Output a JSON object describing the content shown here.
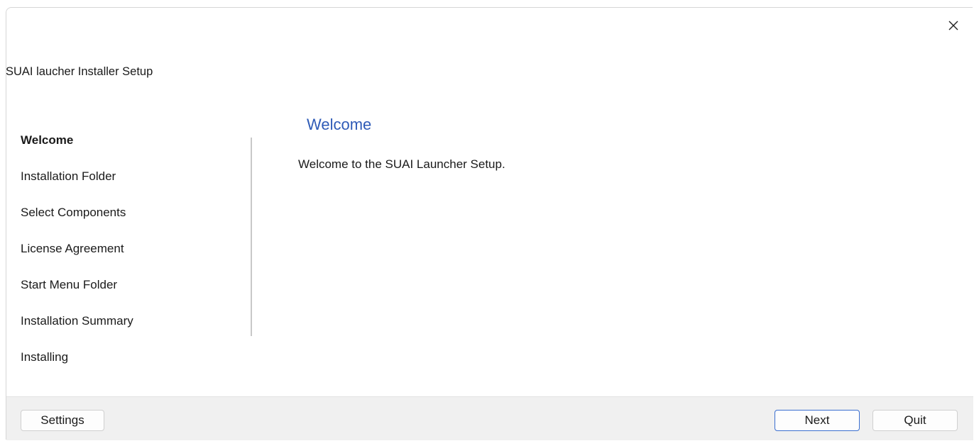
{
  "window": {
    "title": "SUAI laucher Installer Setup",
    "close_icon": "close-icon"
  },
  "sidebar": {
    "items": [
      {
        "label": "Welcome",
        "active": true
      },
      {
        "label": "Installation Folder",
        "active": false
      },
      {
        "label": "Select Components",
        "active": false
      },
      {
        "label": "License Agreement",
        "active": false
      },
      {
        "label": "Start Menu Folder",
        "active": false
      },
      {
        "label": "Installation Summary",
        "active": false
      },
      {
        "label": "Installing",
        "active": false
      }
    ]
  },
  "page": {
    "heading": "Welcome",
    "body": "Welcome to the SUAI Launcher Setup."
  },
  "footer": {
    "settings_label": "Settings",
    "next_label": "Next",
    "quit_label": "Quit"
  },
  "colors": {
    "heading": "#2f5bb7",
    "primary_border": "#3b6fd0",
    "footer_bg": "#f0f0f0"
  }
}
